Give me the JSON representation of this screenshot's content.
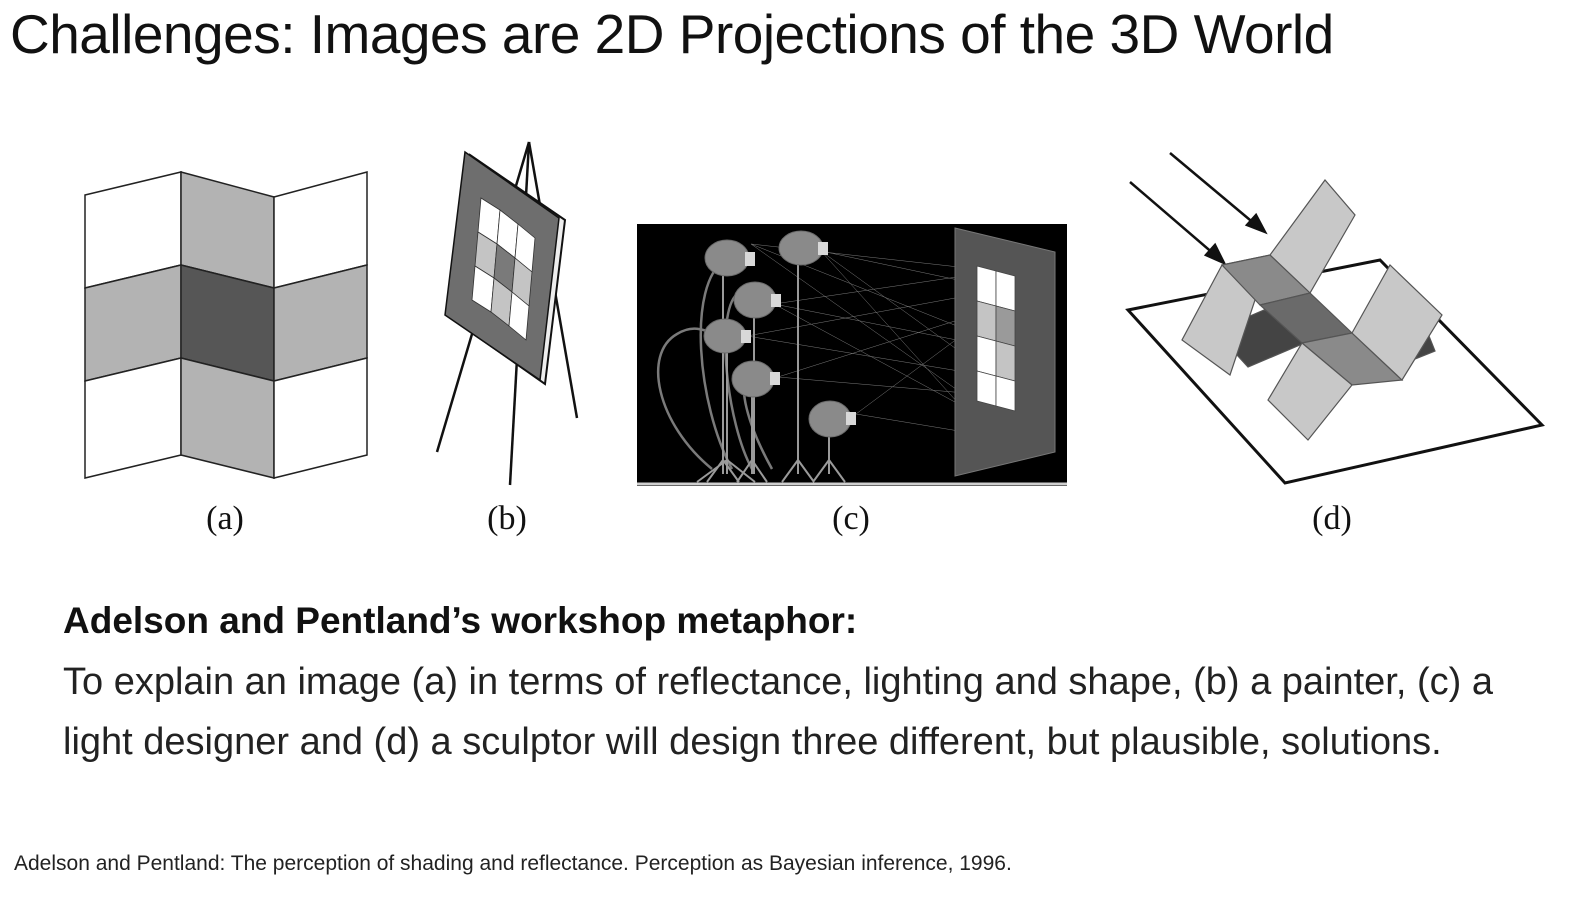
{
  "slide": {
    "title": "Challenges: Images are 2D Projections of the 3D World",
    "figures": [
      {
        "caption": "(a)"
      },
      {
        "caption": "(b)"
      },
      {
        "caption": "(c)"
      },
      {
        "caption": "(d)"
      }
    ],
    "heading": "Adelson and Pentland’s workshop metaphor:",
    "body": "To explain an image (a) in terms of reflectance, lighting and shape, (b) a painter, (c) a light designer and (d) a sculptor will design three different, but plausible, solutions.",
    "citation": "Adelson and Pentland: The perception of shading and reflectance. Perception as Bayesian inference, 1996."
  },
  "colors": {
    "white_patch": "#ffffff",
    "light_gray": "#b3b3b3",
    "dark_gray": "#565656",
    "mid_gray": "#8a8a8a",
    "black_bg": "#000000"
  }
}
